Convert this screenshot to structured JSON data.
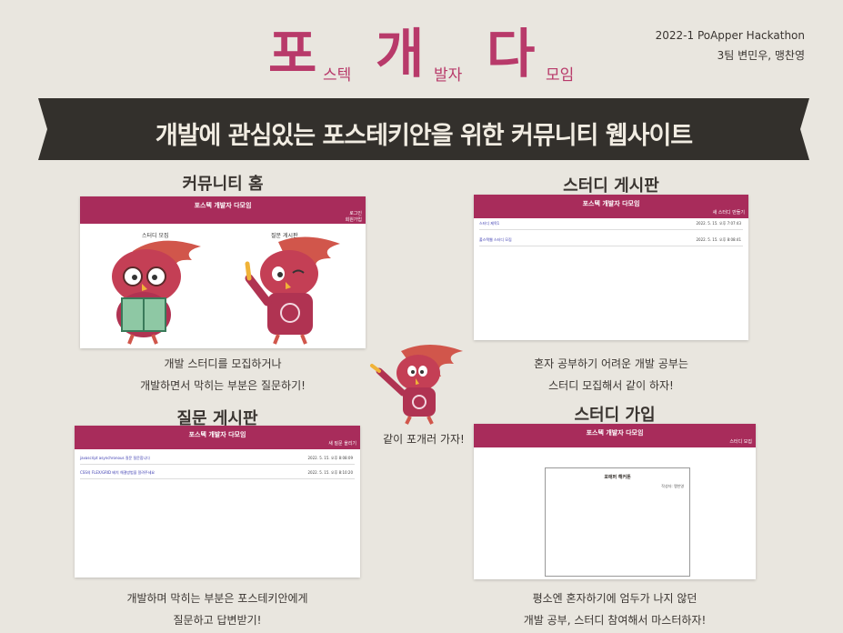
{
  "header": {
    "big1": "포",
    "small1": "스텍",
    "big2": "개",
    "small2": "발자",
    "big3": "다",
    "small3": "모임",
    "event": "2022-1 PoApper Hackathon",
    "team": "3팀 변민우, 맹찬영"
  },
  "banner": {
    "text": "개발에 관심있는 포스테키안을 위한 커뮤니티 웹사이트"
  },
  "sections": {
    "home": {
      "title": "커뮤니티 홈",
      "app_title": "포스텍 개발자 다모임",
      "login": "로그인",
      "signup": "회원가입",
      "label_study": "스터디 모집",
      "label_qna": "질문 게시판",
      "caption1": "개발 스터디를 모집하거나",
      "caption2": "개발하면서 막히는 부분은 질문하기!"
    },
    "study_board": {
      "title": "스터디 게시판",
      "app_title": "포스텍 개발자 다모임",
      "corner": "새 스터디 만들기",
      "rows": [
        {
          "name": "스터디 제목1",
          "date": "2022. 5. 15. 오후 7:07:43"
        },
        {
          "name": "풀스택웹 스터디 모집",
          "date": "2022. 5. 15. 오후 8:08:41"
        }
      ],
      "caption1": "혼자 공부하기 어려운 개발 공부는",
      "caption2": "스터디 모집해서 같이 하자!"
    },
    "qna_board": {
      "title": "질문 게시판",
      "app_title": "포스텍 개발자 다모임",
      "corner": "새 질문 올리기",
      "rows": [
        {
          "name": "javascript asynchronous 질문 질문합니다",
          "date": "2022. 5. 15. 오후 8:08:09"
        },
        {
          "name": "CSS의 FLEX/GRID 배치 해결방법을 알려주세요",
          "date": "2022. 5. 15. 오후 8:10:20"
        }
      ],
      "caption1": "개발하며 막히는 부분은 포스테키안에게",
      "caption2": "질문하고 답변받기!"
    },
    "join": {
      "title": "스터디 가입",
      "app_title": "포스텍 개발자 다모임",
      "corner": "스터디 모집",
      "dialog_title": "포애퍼 해커톤",
      "dialog_meta": "작성자: 맹찬영",
      "caption1": "평소엔 혼자하기에 엄두가 나지 않던",
      "caption2": "개발 공부, 스터디 참여해서 마스터하자!"
    }
  },
  "center_caption": "같이 포개러 가자!",
  "colors": {
    "accent": "#b83a6a",
    "bar": "#a82c5b",
    "banner": "#33302c",
    "background": "#e9e6df"
  },
  "icons": [
    "mascot-reading",
    "mascot-pointing-up",
    "mascot-pointing"
  ]
}
